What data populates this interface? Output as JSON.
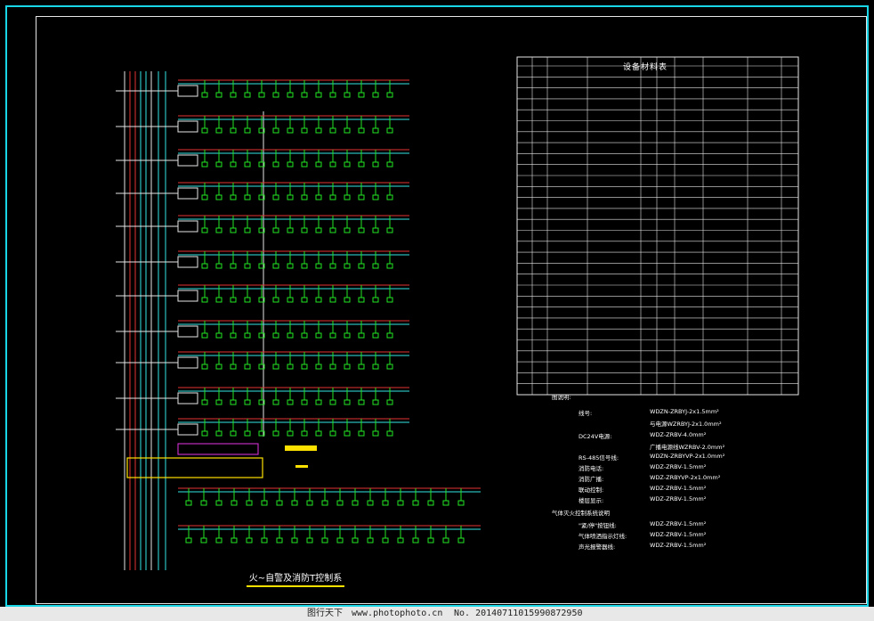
{
  "drawing": {
    "title": "火~自警及消防T控制系",
    "equipment_table_title": "设备材料表",
    "colors": {
      "background": "#000000",
      "frame": "#19d6e6",
      "red_bus": "#e53333",
      "cyan_bus": "#33e6e6",
      "green_device": "#22e622",
      "magenta_device": "#e633e6",
      "yellow_label": "#ffe100",
      "white_line": "#e6e6e6"
    },
    "notes_heading": "图说明:",
    "notes": [
      {
        "label": "线号:",
        "value": "WDZN-ZRBYJ-2x1.5mm²"
      },
      {
        "label": "",
        "value": "与电源WZRBYJ-2x1.0mm²"
      },
      {
        "label": "DC24V电源:",
        "value": "WDZ-ZRBV-4.0mm²"
      },
      {
        "label": "",
        "value": "广播电源线WZRBV-2.0mm²"
      },
      {
        "label": "RS-485信号线:",
        "value": "WDZN-ZRBYVP-2x1.0mm²"
      },
      {
        "label": "消防电话:",
        "value": "WDZ-ZRBV-1.5mm²"
      },
      {
        "label": "消防广播:",
        "value": "WDZ-ZRBYVP-2x1.0mm²"
      },
      {
        "label": "联动控制:",
        "value": "WDZ-ZRBV-1.5mm²"
      },
      {
        "label": "楼层显示:",
        "value": "WDZ-ZRBV-1.5mm²"
      }
    ],
    "notes_heading2": "气体灭火控制系统说明",
    "notes2": [
      {
        "label": "\"紧/停\"按钮线:",
        "value": "WDZ-ZRBV-1.5mm²"
      },
      {
        "label": "气体喷洒指示灯线:",
        "value": "WDZ-ZRBV-1.5mm²"
      },
      {
        "label": "声光报警器线:",
        "value": "WDZ-ZRBV-1.5mm²"
      }
    ]
  },
  "footer": {
    "watermark1": "图行天下",
    "watermark2": "www.photophoto.cn",
    "watermark3": "No. 20140711015990872950"
  }
}
